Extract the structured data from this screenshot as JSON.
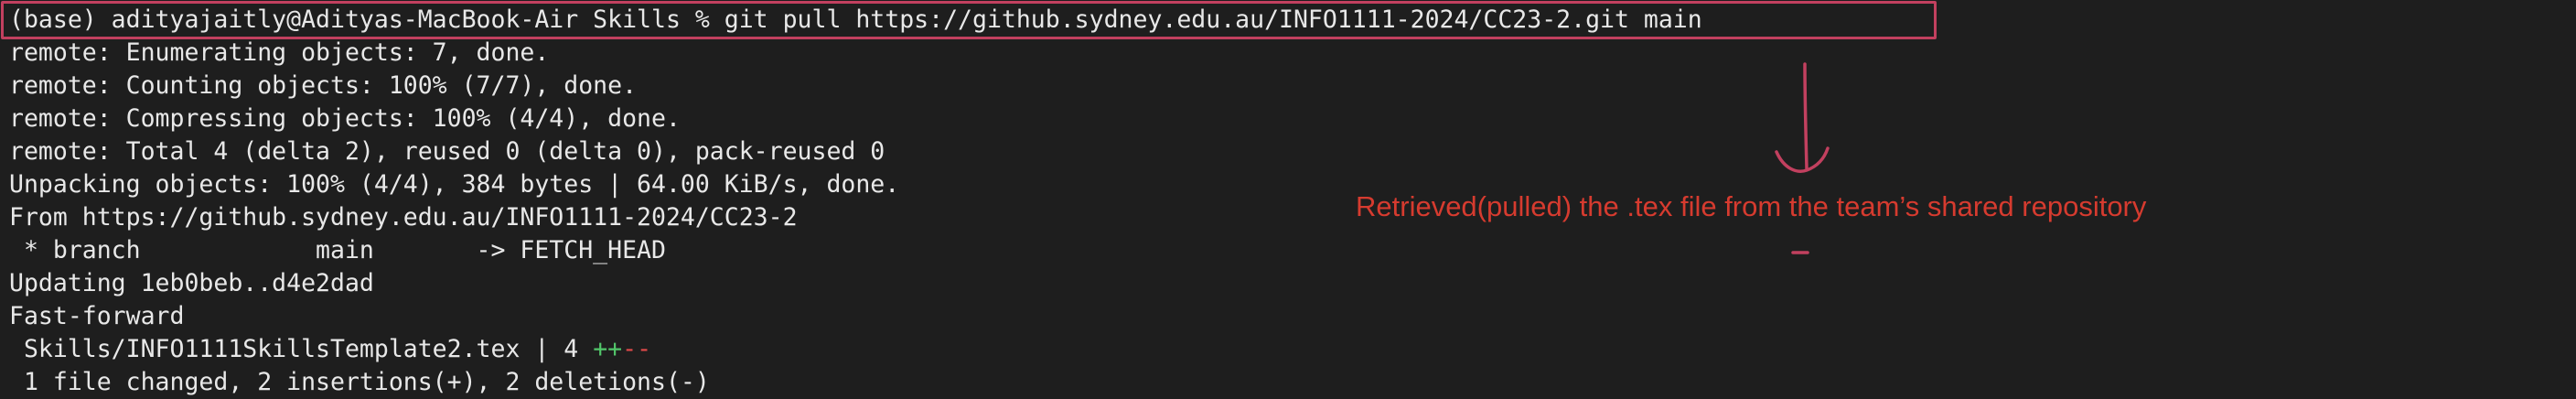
{
  "terminal": {
    "command": "(base) adityajaitly@Adityas-MacBook-Air Skills % git pull https://github.sydney.edu.au/INFO1111-2024/CC23-2.git main",
    "output": [
      "remote: Enumerating objects: 7, done.",
      "remote: Counting objects: 100% (7/7), done.",
      "remote: Compressing objects: 100% (4/4), done.",
      "remote: Total 4 (delta 2), reused 0 (delta 0), pack-reused 0",
      "Unpacking objects: 100% (4/4), 384 bytes | 64.00 KiB/s, done.",
      "From https://github.sydney.edu.au/INFO1111-2024/CC23-2",
      " * branch            main       -> FETCH_HEAD",
      "Updating 1eb0beb..d4e2dad",
      "Fast-forward"
    ],
    "diffstat": {
      "prefix": " Skills/INFO1111SkillsTemplate2.tex | 4 ",
      "plus": "++",
      "minus": "--"
    },
    "summary": " 1 file changed, 2 insertions(+), 2 deletions(-)"
  },
  "annotation": {
    "text": "Retrieved(pulled) the .tex file from the team’s shared repository",
    "color": "#d63b2f",
    "highlight_color": "#c2405f"
  },
  "colors": {
    "background": "#1e1e1e",
    "text": "#e8e8e8",
    "diff_plus": "#52c66a",
    "diff_minus": "#e24a4a"
  }
}
